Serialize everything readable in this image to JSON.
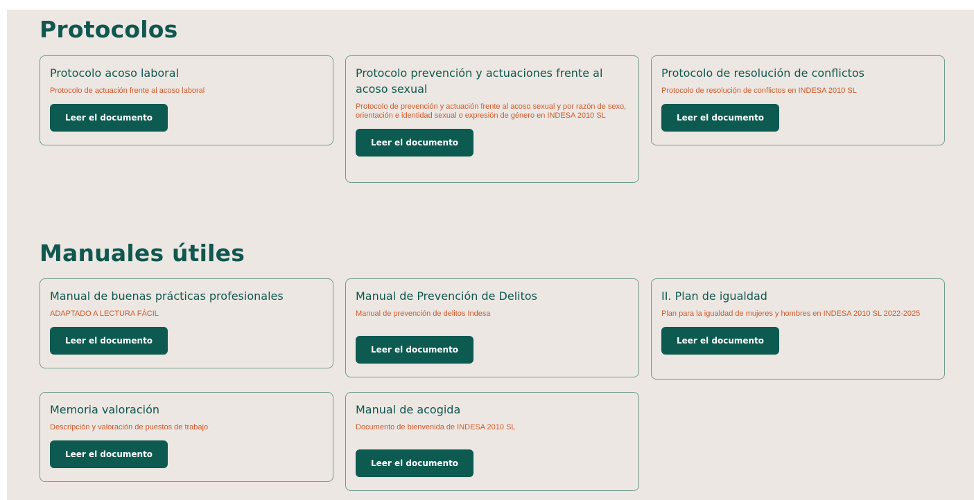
{
  "colors": {
    "background": "#ece7e2",
    "heading": "#0f574f",
    "description": "#d0592a",
    "button": "#0d5a51",
    "card_border": "#6f9a8e"
  },
  "sections": [
    {
      "title": "Protocolos",
      "cards": [
        {
          "title": "Protocolo acoso laboral",
          "description": "Protocolo de actuación frente al acoso laboral",
          "button_label": "Leer el documento"
        },
        {
          "title": "Protocolo prevención y actuaciones frente al acoso sexual",
          "description": "Protocolo de prevención y actuación frente al acoso sexual y por razón de sexo, orientación e identidad sexual o expresión de género en INDESA 2010 SL",
          "button_label": "Leer el documento"
        },
        {
          "title": "Protocolo de resolución de conflictos",
          "description": "Protocolo de resolución de conflictos en INDESA 2010 SL",
          "button_label": "Leer el documento"
        }
      ]
    },
    {
      "title": "Manuales útiles",
      "cards": [
        {
          "title": "Manual de buenas prácticas profesionales",
          "description": "ADAPTADO A LECTURA FÁCIL",
          "button_label": "Leer el documento"
        },
        {
          "title": "Manual de Prevención de Delitos",
          "description": "Manual de prevención de delitos Indesa",
          "button_label": "Leer el documento"
        },
        {
          "title": "II. Plan de igualdad",
          "description": "Plan para la igualdad de mujeres y hombres en INDESA 2010 SL 2022-2025",
          "button_label": "Leer el documento"
        },
        {
          "title": "Memoria valoración",
          "description": "Descripción y valoración de puestos de trabajo",
          "button_label": "Leer el documento"
        },
        {
          "title": "Manual de acogida",
          "description": "Documento de bienvenida de INDESA 2010 SL",
          "button_label": "Leer el documento"
        }
      ]
    }
  ]
}
